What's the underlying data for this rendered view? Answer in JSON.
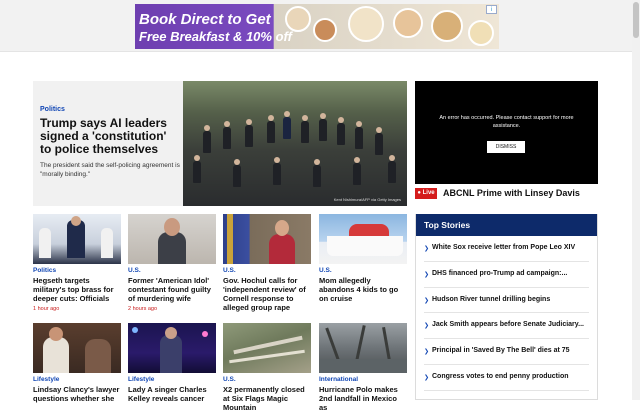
{
  "ad": {
    "headline": "Book Direct to Get",
    "subline": "Free Breakfast & 10% off",
    "adchoices": "i"
  },
  "hero": {
    "category": "Politics",
    "title": "Trump says AI leaders signed a 'constitution' to police themselves",
    "summary": "The president said the self-policing agreement is \"morally binding.\"",
    "photo_credit": "Kent Nishimura/AFP via Getty Images"
  },
  "video": {
    "error_text": "An error has occurred. Please contact support for more assistance.",
    "dismiss_label": "DISMISS"
  },
  "live": {
    "badge": "Live",
    "title": "ABCNL Prime with Linsey Davis"
  },
  "cards": [
    {
      "category": "Politics",
      "title": "Hegseth targets military's top brass for deeper cuts: Officials",
      "time": "1 hour ago"
    },
    {
      "category": "U.S.",
      "title": "Former 'American Idol' contestant found guilty of murdering wife",
      "time": "2 hours ago"
    },
    {
      "category": "U.S.",
      "title": "Gov. Hochul calls for 'independent review' of Cornell response to alleged group rape",
      "time": ""
    },
    {
      "category": "U.S.",
      "title": "Mom allegedly abandons 4 kids to go on cruise",
      "time": ""
    },
    {
      "category": "Lifestyle",
      "title": "Lindsay Clancy's lawyer questions whether she",
      "time": ""
    },
    {
      "category": "Lifestyle",
      "title": "Lady A singer Charles Kelley reveals cancer",
      "time": ""
    },
    {
      "category": "U.S.",
      "title": "X2 permanently closed at Six Flags Magic Mountain",
      "time": ""
    },
    {
      "category": "International",
      "title": "Hurricane Polo makes 2nd landfall in Mexico as",
      "time": ""
    }
  ],
  "top_stories": {
    "header": "Top Stories",
    "items": [
      "White Sox receive letter from Pope Leo XIV",
      "DHS financed pro-Trump ad campaign:...",
      "Hudson River tunnel drilling begins",
      "Jack Smith appears before Senate Judiciary...",
      "Principal in 'Saved By The Bell' dies at 75",
      "Congress votes to end penny production"
    ]
  },
  "colors": {
    "accent_blue": "#1146b4",
    "top_stories_header": "#0d2a6a",
    "live_red": "#d41c1c",
    "ad_purple": "#6e3fb0"
  }
}
